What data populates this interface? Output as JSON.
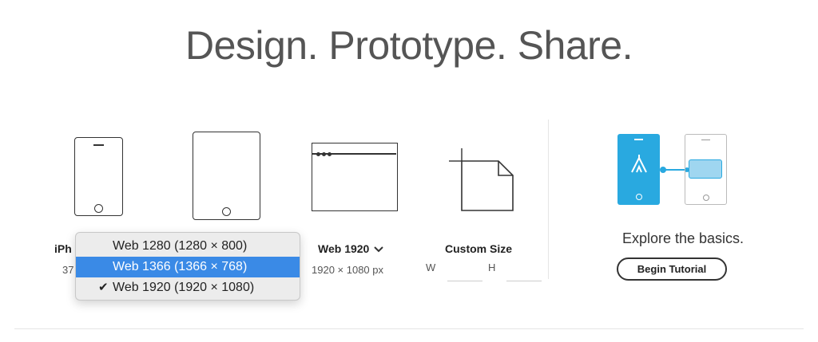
{
  "header": {
    "title": "Design. Prototype. Share."
  },
  "presets": [
    {
      "name": "iPh",
      "size": "37"
    },
    {
      "name": "",
      "size": ""
    },
    {
      "name": "Web 1920",
      "size": "1920 × 1080 px"
    },
    {
      "name": "Custom Size",
      "w_label": "W",
      "h_label": "H"
    }
  ],
  "dropdown": {
    "items": [
      {
        "label": "Web 1280 (1280 × 800)",
        "selected": false,
        "checked": false
      },
      {
        "label": "Web 1366 (1366 × 768)",
        "selected": true,
        "checked": false
      },
      {
        "label": "Web 1920 (1920 × 1080)",
        "selected": false,
        "checked": true
      }
    ]
  },
  "tutorial": {
    "explore_text": "Explore the basics.",
    "button_label": "Begin Tutorial"
  },
  "colors": {
    "accent": "#29a9e0",
    "selection": "#3a8ae6",
    "tutorial_panel": "#9fd6f0"
  }
}
